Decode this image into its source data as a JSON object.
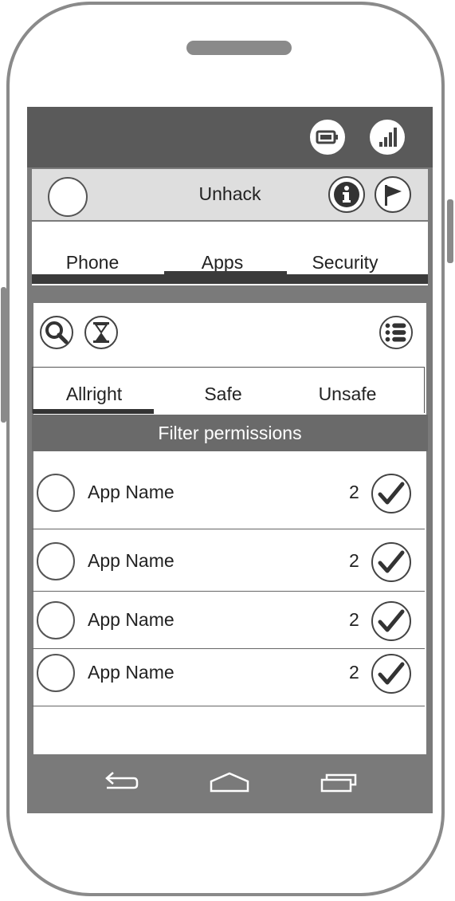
{
  "colors": {
    "status_bar": "#5a5a5a",
    "app_bar": "#dedede",
    "filter_bar": "#6a6a6a",
    "nav_bar": "#7a7a7a"
  },
  "status_bar": {
    "icons": [
      "battery-icon",
      "signal-icon"
    ]
  },
  "app_bar": {
    "title": "Unhack",
    "icons": [
      "avatar-icon",
      "info-icon",
      "flag-icon"
    ]
  },
  "main_tabs": [
    {
      "label": "Phone"
    },
    {
      "label": "Apps",
      "selected": true
    },
    {
      "label": "Security"
    }
  ],
  "toolbar": {
    "icons": [
      "search-icon",
      "hourglass-icon",
      "menu-list-icon"
    ]
  },
  "sub_tabs": [
    {
      "label": "Allright",
      "selected": true
    },
    {
      "label": "Safe"
    },
    {
      "label": "Unsafe"
    }
  ],
  "filter": {
    "label": "Filter permissions"
  },
  "apps": [
    {
      "name": "App Name",
      "count": "2",
      "checked": true
    },
    {
      "name": "App Name",
      "count": "2",
      "checked": true
    },
    {
      "name": "App Name",
      "count": "2",
      "checked": true
    },
    {
      "name": "App Name",
      "count": "2",
      "checked": true
    }
  ],
  "nav_bar": {
    "icons": [
      "back-icon",
      "home-icon",
      "recent-apps-icon"
    ]
  }
}
